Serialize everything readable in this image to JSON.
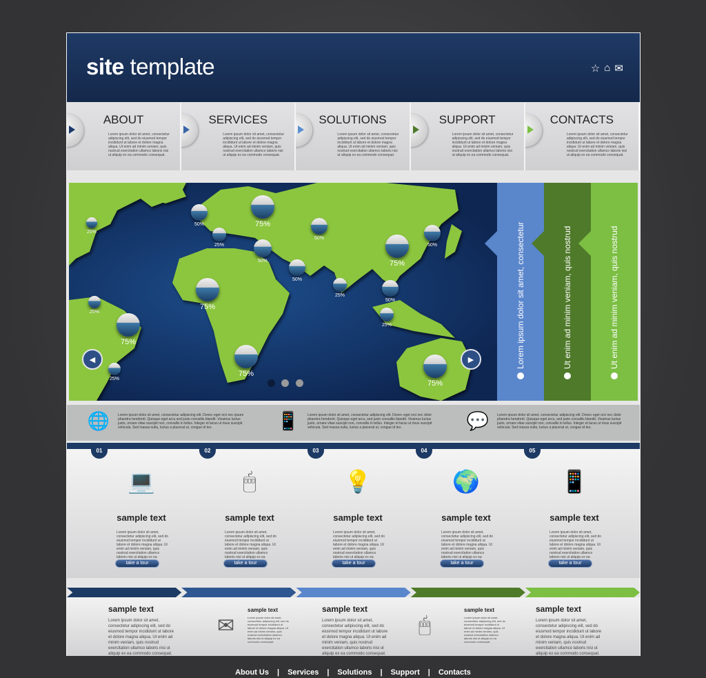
{
  "header": {
    "title_bold": "site",
    "title_rest": " template",
    "icons": [
      "star-icon",
      "home-icon",
      "mail-icon"
    ]
  },
  "nav": [
    {
      "label": "ABOUT",
      "arrow_color": "#1b3a6b",
      "text": "Lorem ipsum dolor sit amet, consectetur adipiscing elit, sed do eiusmod tempor incididunt ut labore et dolore magna aliqua. Ut enim ad minim veniam, quis nostrud exercitation ullamco laboris nisi ut aliquip ex ea commodo consequat."
    },
    {
      "label": "SERVICES",
      "arrow_color": "#3a65a8",
      "text": "Lorem ipsum dolor sit amet, consectetur adipiscing elit, sed do eiusmod tempor incididunt ut labore et dolore magna aliqua. Ut enim ad minim veniam, quis nostrud exercitation ullamco laboris nisi ut aliquip ex ea commodo consequat."
    },
    {
      "label": "SOLUTIONS",
      "arrow_color": "#5a8fd0",
      "text": "Lorem ipsum dolor sit amet, consectetur adipiscing elit, sed do eiusmod tempor incididunt ut labore et dolore magna aliqua. Ut enim ad minim veniam, quis nostrud exercitation ullamco laboris nisi ut aliquip ex ea commodo consequat."
    },
    {
      "label": "SUPPORT",
      "arrow_color": "#4e7a2c",
      "text": "Lorem ipsum dolor sit amet, consectetur adipiscing elit, sed do eiusmod tempor incididunt ut labore et dolore magna aliqua. Ut enim ad minim veniam, quis nostrud exercitation ullamco laboris nisi ut aliquip ex ea commodo consequat."
    },
    {
      "label": "CONTACTS",
      "arrow_color": "#7bc043",
      "text": "Lorem ipsum dolor sit amet, consectetur adipiscing elit, sed do eiusmod tempor incididunt ut labore et dolore magna aliqua. Ut enim ad minim veniam, quis nostrud exercitation ullamco laboris nisi ut aliquip ex ea commodo consequat."
    }
  ],
  "map": {
    "pins": [
      "25%",
      "50%",
      "75%",
      "25%",
      "50%",
      "50%",
      "50%",
      "75%",
      "25%",
      "75%",
      "50%",
      "50%",
      "25%",
      "25%",
      "75%",
      "25%",
      "75%",
      "75%"
    ],
    "slides": 3,
    "active_slide": 1
  },
  "panels": [
    {
      "text": "Lorem ipsum dolor sit amet, consectetur",
      "color": "#5a86cc"
    },
    {
      "text": "Ut enim ad minim veniam, quis nostrud",
      "color": "#4f7a2a"
    },
    {
      "text": "Ut enim ad minim veniam, quis nostrud",
      "color": "#7cbf43"
    }
  ],
  "info": [
    {
      "icon": "globe-icon",
      "text": "Lorem ipsum dolor sit amet, consectetur adipiscing elit. Donec eget orci nec ipsum pharetra hendrerit. Quisque eget arcu sed justo convallis blandit. Vivamus luctus justo, ornare vitae suscipit non, convallis in tellus. Integer et lacus ut risus suscipit vehicula. Sed massa nulla, luctus a placerat ut, congue id leo."
    },
    {
      "icon": "mobile-phones-icon",
      "text": "Lorem ipsum dolor sit amet, consectetur adipiscing elit. Donec eget orci nec dolor pharetra hendrerit. Quisque eget arcu, sed justo convallis blandit. Vivamus luctus justo, ornare vitae suscipit non, convallis in tellus. Integer et lacus ut risus suscipit vehicula. Sed massa nulla, luctus a placerat ut, congue id leo."
    },
    {
      "icon": "speech-bubbles-icon",
      "text": "Lorem ipsum dolor sit amet, consectetur adipiscing elit. Donec eget orci nec dolor pharetra hendrerit. Quisque eget arcu, sed justo convallis blandit. Vivamus luctus justo, ornare vitae suscipit non, convallis in tellus. Integer et lacus ut risus suscipit vehicula. Sed massa nulla, luctus a placerat ut, congue id leo."
    }
  ],
  "features": [
    {
      "num": "01",
      "icon": "laptop-icon",
      "glyph": "💻",
      "title": "sample text",
      "text": "Lorem ipsum dolor sit amet, consectetur adipiscing elit, sed do eiusmod tempor incididunt ut labore et dolore magna aliqua. Ut enim ad minim veniam, quis nostrud exercitation ullamco laboris nisi ut aliquip ex ea commodo consequat.",
      "button": "take a tour"
    },
    {
      "num": "02",
      "icon": "mouse-icon",
      "glyph": "🖱",
      "title": "sample text",
      "text": "Lorem ipsum dolor sit amet, consectetur adipiscing elit, sed do eiusmod tempor incididunt ut labore et dolore magna aliqua. Ut enim ad minim veniam, quis nostrud exercitation ullamco laboris nisi ut aliquip ex ea commodo consequat.",
      "button": "take a tour"
    },
    {
      "num": "03",
      "icon": "lightbulb-icon",
      "glyph": "💡",
      "title": "sample text",
      "text": "Lorem ipsum dolor sit amet, consectetur adipiscing elit, sed do eiusmod tempor incididunt ut labore et dolore magna aliqua. Ut enim ad minim veniam, quis nostrud exercitation ullamco laboris nisi ut aliquip ex ea commodo consequat.",
      "button": "take a tour"
    },
    {
      "num": "04",
      "icon": "globe-plane-icon",
      "glyph": "🌍",
      "title": "sample text",
      "text": "Lorem ipsum dolor sit amet, consectetur adipiscing elit, sed do eiusmod tempor incididunt ut labore et dolore magna aliqua. Ut enim ad minim veniam, quis nostrud exercitation ullamco laboris nisi ut aliquip ex ea commodo consequat.",
      "button": "take a tour"
    },
    {
      "num": "05",
      "icon": "mobile-phone-icon",
      "glyph": "📱",
      "title": "sample text",
      "text": "Lorem ipsum dolor sit amet, consectetur adipiscing elit, sed do eiusmod tempor incididunt ut labore et dolore magna aliqua. Ut enim ad minim veniam, quis nostrud exercitation ullamco laboris nisi ut aliquip ex ea commodo consequat.",
      "button": "take a tour"
    }
  ],
  "strip_colors": [
    "#1d3a64",
    "#2f5791",
    "#5a86cc",
    "#4f7a2a",
    "#7cbf43"
  ],
  "bottom": {
    "large": [
      {
        "title": "sample text",
        "text": "Lorem ipsum dolor sit amet, consectetur adipiscing elit, sed do eiusmod tempor incididunt ut labore et dolore magna aliqua. Ut enim ad minim veniam, quis nostrud exercitation ullamco laboris nisi ut aliquip ex ea commodo consequat."
      },
      {
        "title": "sample text",
        "text": "Lorem ipsum dolor sit amet, consectetur adipiscing elit, sed do eiusmod tempor incididunt ut labore et dolore magna aliqua. Ut enim ad minim veniam, quis nostrud exercitation ullamco laboris nisi ut aliquip ex ea commodo consequat."
      },
      {
        "title": "sample text",
        "text": "Lorem ipsum dolor sit amet, consectetur adipiscing elit, sed do eiusmod tempor incididunt ut labore et dolore magna aliqua. Ut enim ad minim veniam, quis nostrud exercitation ullamco laboris nisi ut aliquip ex ea commodo consequat."
      }
    ],
    "small": [
      {
        "icon": "globe-envelope-icon",
        "glyph": "✉",
        "title": "sample text",
        "text": "Lorem ipsum dolor sit amet, consectetur adipiscing elit, sed do eiusmod tempor incididunt ut labore et dolore magna aliqua. Ut enim ad minim veniam, quis nostrud exercitation ullamco laboris nisi ut aliquip ex ea commodo consequat."
      },
      {
        "icon": "mouse-icon",
        "glyph": "🖱",
        "title": "sample text",
        "text": "Lorem ipsum dolor sit amet, consectetur adipiscing elit, sed do eiusmod tempor incididunt ut labore et dolore magna aliqua. Ut enim ad minim veniam, quis nostrud exercitation ullamco laboris nisi ut aliquip ex ea commodo consequat."
      }
    ]
  },
  "footer": [
    "About Us",
    "Services",
    "Solutions",
    "Support",
    "Contacts"
  ]
}
